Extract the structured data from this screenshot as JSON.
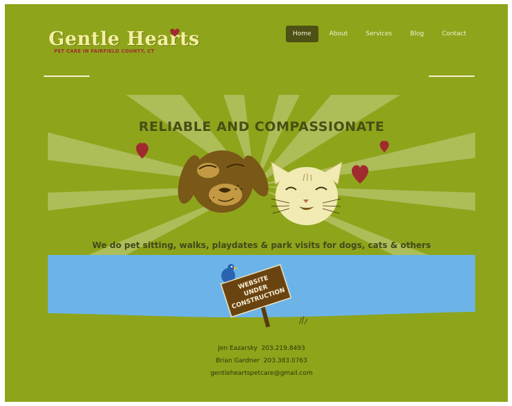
{
  "logo": {
    "title": "Gentle Hearts",
    "subtitle": "PET CARE IN FAIRFIELD COUNTY, CT"
  },
  "nav": {
    "items": [
      "Home",
      "About",
      "Services",
      "Blog",
      "Contact"
    ],
    "active": "Home"
  },
  "hero": {
    "title": "RELIABLE AND COMPASSIONATE",
    "tagline": "We do pet sitting, walks, playdates & park visits for dogs, cats & others"
  },
  "sign": {
    "line1": "WEBSITE",
    "line2": "UNDER",
    "line3": "CONSTRUCTION"
  },
  "contact": {
    "line1": "Jen Eazarsky  203.219.8493",
    "line2": "Brian Gardner  203.383.0763",
    "email": "gentleheartspetcare@gmail.com"
  },
  "colors": {
    "background": "#8ea41b",
    "sky": "#6cb4e8",
    "grass": "#8ea41b",
    "heart": "#a12a2f",
    "nav_active": "#4d5116"
  }
}
